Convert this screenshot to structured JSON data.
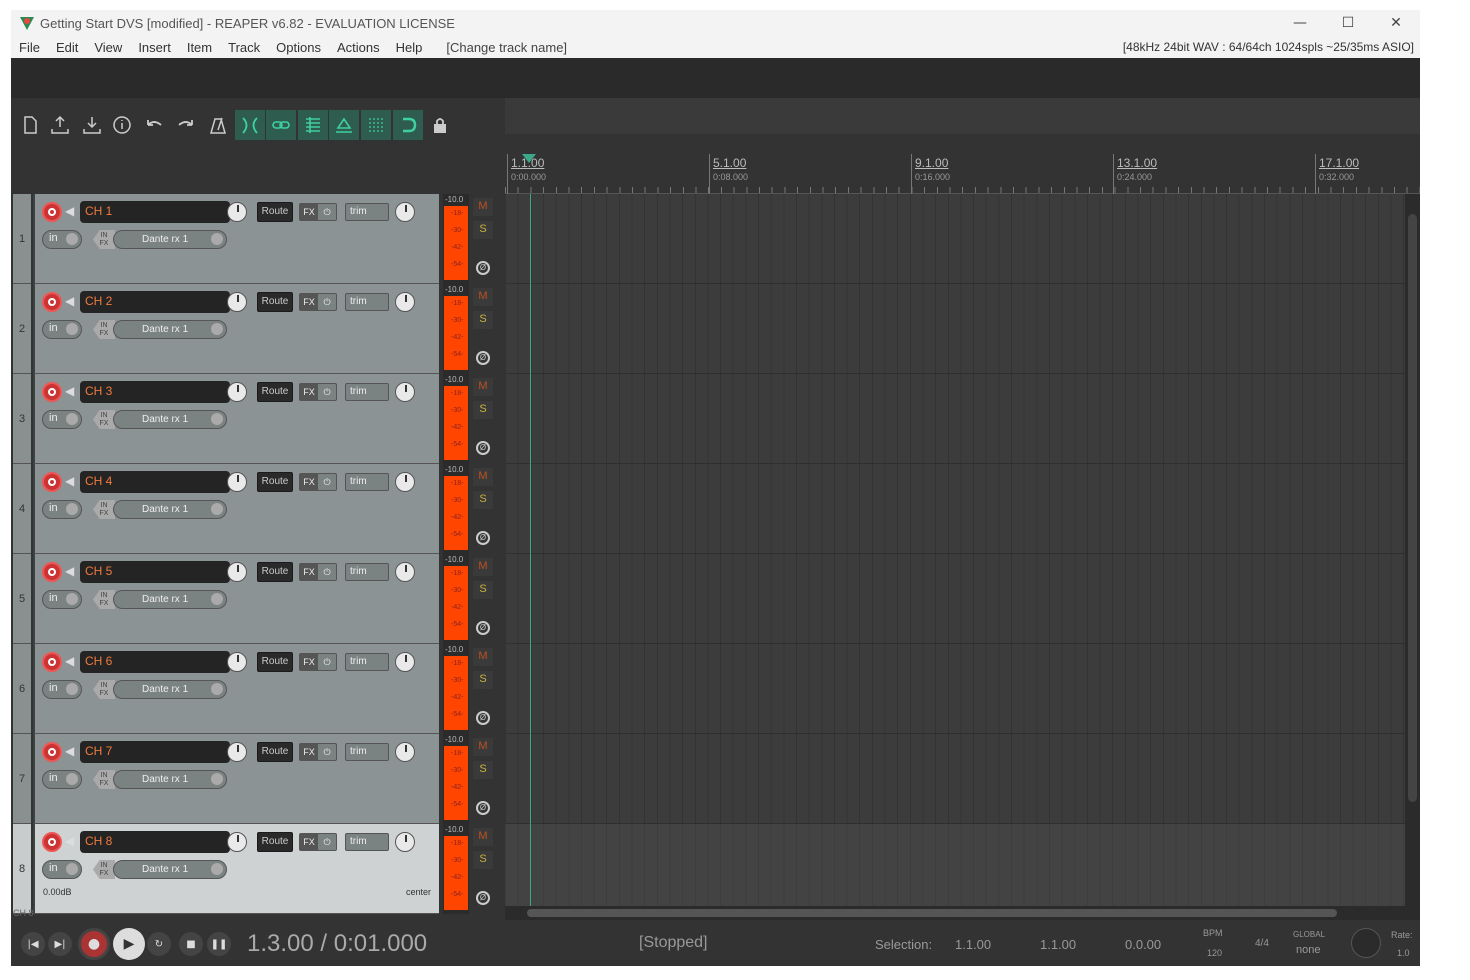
{
  "window": {
    "title": "Getting Start DVS [modified] - REAPER v6.82 - EVALUATION LICENSE",
    "minimize": "—",
    "maximize": "☐",
    "close": "✕"
  },
  "menu": {
    "items": [
      "File",
      "Edit",
      "View",
      "Insert",
      "Item",
      "Track",
      "Options",
      "Actions",
      "Help"
    ],
    "extra": "[Change track name]",
    "status": "[48kHz 24bit WAV : 64/64ch 1024spls ~25/35ms ASIO]"
  },
  "toolbar": {
    "icons": [
      "new-project-icon",
      "upload-icon",
      "download-icon",
      "info-icon",
      "undo-icon",
      "redo-icon",
      "metronome-icon",
      "ripple-icon",
      "link-icon",
      "grid-icon",
      "envelope-icon",
      "snap-grid-icon",
      "magnet-icon",
      "lock-icon"
    ],
    "active": [
      "ripple-icon",
      "link-icon",
      "grid-icon",
      "envelope-icon",
      "snap-grid-icon",
      "magnet-icon"
    ]
  },
  "ruler": {
    "markers": [
      {
        "label": "1.1.00",
        "time": "0:00.000"
      },
      {
        "label": "5.1.00",
        "time": "0:08.000"
      },
      {
        "label": "9.1.00",
        "time": "0:16.000"
      },
      {
        "label": "13.1.00",
        "time": "0:24.000"
      },
      {
        "label": "17.1.00",
        "time": "0:32.000"
      }
    ]
  },
  "tracks": [
    {
      "num": "1",
      "name": "CH 1",
      "route": "Route",
      "fx": "FX",
      "trim": "trim",
      "in": "in",
      "input": "Dante rx 1"
    },
    {
      "num": "2",
      "name": "CH 2",
      "route": "Route",
      "fx": "FX",
      "trim": "trim",
      "in": "in",
      "input": "Dante rx 1"
    },
    {
      "num": "3",
      "name": "CH 3",
      "route": "Route",
      "fx": "FX",
      "trim": "trim",
      "in": "in",
      "input": "Dante rx 1"
    },
    {
      "num": "4",
      "name": "CH 4",
      "route": "Route",
      "fx": "FX",
      "trim": "trim",
      "in": "in",
      "input": "Dante rx 1"
    },
    {
      "num": "5",
      "name": "CH 5",
      "route": "Route",
      "fx": "FX",
      "trim": "trim",
      "in": "in",
      "input": "Dante rx 1"
    },
    {
      "num": "6",
      "name": "CH 6",
      "route": "Route",
      "fx": "FX",
      "trim": "trim",
      "in": "in",
      "input": "Dante rx 1"
    },
    {
      "num": "7",
      "name": "CH 7",
      "route": "Route",
      "fx": "FX",
      "trim": "trim",
      "in": "in",
      "input": "Dante rx 1"
    },
    {
      "num": "8",
      "name": "CH 8",
      "route": "Route",
      "fx": "FX",
      "trim": "trim",
      "in": "in",
      "input": "Dante rx 1",
      "volume": "0.00dB",
      "pan": "center",
      "selected": true
    }
  ],
  "meter": {
    "db": "-10.0",
    "scale": [
      "-18-",
      "-30-",
      "-42-",
      "-54-"
    ],
    "mute": "M",
    "solo": "S",
    "phase": "Ø"
  },
  "selected_track_label": "CH 8",
  "transport": {
    "position": "1.3.00 / 0:01.000",
    "status": "[Stopped]",
    "selection_label": "Selection:",
    "selection_start": "1.1.00",
    "selection_end": "1.1.00",
    "selection_length": "0.0.00",
    "bpm_label": "BPM",
    "bpm": "120",
    "time_signature": "4/4",
    "automation_label": "GLOBAL",
    "automation_mode": "none",
    "rate_label": "Rate:",
    "rate": "1.0"
  },
  "colors": {
    "accent": "#3aa889",
    "track_name": "#f07a3c",
    "meter": "#ff4500",
    "record": "#cc3333"
  }
}
